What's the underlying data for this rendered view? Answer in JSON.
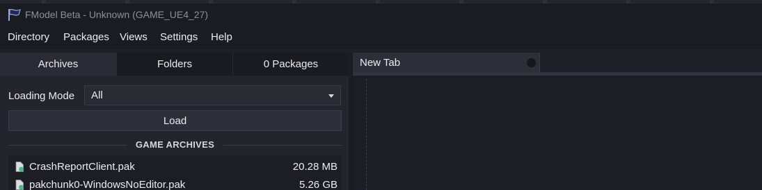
{
  "window": {
    "title": "FModel Beta - Unknown (GAME_UE4_27)",
    "icon": "fmodel-flag-icon"
  },
  "menu": [
    "Directory",
    "Packages",
    "Views",
    "Settings",
    "Help"
  ],
  "left_tabs": [
    {
      "label": "Archives",
      "active": true
    },
    {
      "label": "Folders",
      "active": false
    },
    {
      "label": "0 Packages",
      "active": false
    }
  ],
  "loading_mode": {
    "label": "Loading Mode",
    "value": "All"
  },
  "load_button": "Load",
  "section_title": "GAME ARCHIVES",
  "archives": [
    {
      "name": "CrashReportClient.pak",
      "size": "20.28 MB"
    },
    {
      "name": "pakchunk0-WindowsNoEditor.pak",
      "size": "5.26 GB"
    }
  ],
  "document_tab": {
    "label": "New Tab"
  },
  "colors": {
    "background": "#1f1f28",
    "panel": "#24242d",
    "file_icon_badge": "#3fbf7f"
  }
}
